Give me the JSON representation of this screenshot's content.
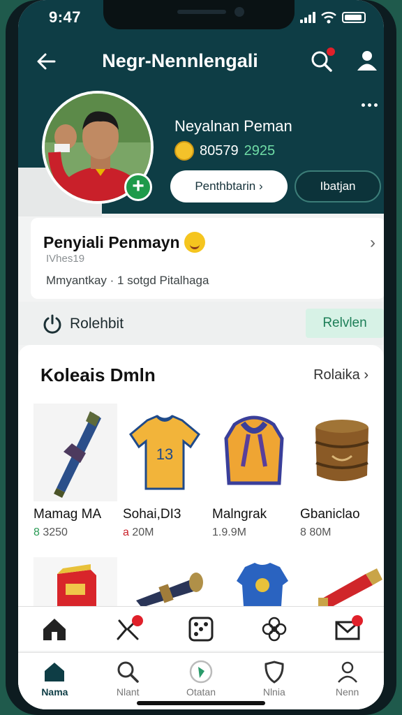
{
  "status_bar": {
    "time": "9:47"
  },
  "header": {
    "title": "Negr-Nennlengali"
  },
  "profile": {
    "name": "Neyalnan Peman",
    "stat_main": "80579",
    "stat_accent": "2925",
    "follow_label": "Penthbtarin",
    "message_label": "Ibatjan"
  },
  "info_card": {
    "title": "Penyiali Penmayn",
    "subtitle": "IVhes19",
    "detail": "Mmyantkay · 1 sotgd Pitalhaga"
  },
  "action_row": {
    "label": "Rolehbit",
    "button_label": "Relvlen"
  },
  "collection": {
    "title": "Koleais Dmln",
    "see_all": "Rolaika",
    "items": [
      {
        "name": "Mamag MA",
        "prefix": "8",
        "price": "3250"
      },
      {
        "name": "Sohai,DI3",
        "prefix": "a",
        "price": "20M"
      },
      {
        "name": "Malngrak",
        "prefix": "",
        "price": "1.9.9M"
      },
      {
        "name": "Gbaniclao",
        "prefix": "",
        "price": "8 80M"
      }
    ],
    "jersey_number": "13"
  },
  "bottom_tabs": [
    {
      "label": "Nama"
    },
    {
      "label": "Nlant"
    },
    {
      "label": "Otatan"
    },
    {
      "label": "Nlnia"
    },
    {
      "label": "Nenn"
    }
  ],
  "colors": {
    "header": "#0e3d45",
    "accent": "#6fdca6",
    "badge": "#e0202a",
    "plus": "#1e9a4a"
  }
}
